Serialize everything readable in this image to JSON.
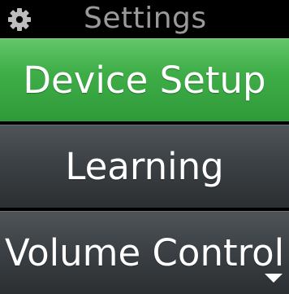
{
  "header": {
    "title": "Settings",
    "icon": "gear-icon"
  },
  "menu": {
    "items": [
      {
        "label": "Device Setup",
        "selected": true
      },
      {
        "label": "Learning",
        "selected": false
      },
      {
        "label": "Volume Control",
        "selected": false
      }
    ],
    "more_indicator": "chevron-down-icon"
  },
  "colors": {
    "selected": "#3fae48",
    "unselected": "#3c4145",
    "title_text": "#9a9a9a",
    "item_text": "#ffffff"
  }
}
